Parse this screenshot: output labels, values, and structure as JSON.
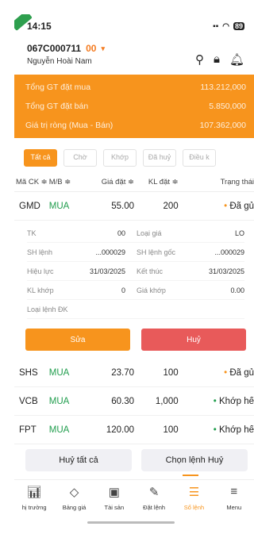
{
  "status": {
    "time": "14:15",
    "battery": "89",
    "signal": "∷",
    "wifi": "☷"
  },
  "account": {
    "id": "067C000711",
    "sub": "00",
    "name": "Nguyễn Hoài Nam"
  },
  "summary": [
    {
      "label": "Tổng GT đặt mua",
      "value": "113.212,000"
    },
    {
      "label": "Tổng GT đặt bán",
      "value": "5.850,000"
    },
    {
      "label": "Giá trị ròng (Mua - Bán)",
      "value": "107.362,000"
    }
  ],
  "tabs": [
    "Tất cả",
    "Chờ",
    "Khớp",
    "Đã huỷ",
    "Điều k"
  ],
  "table": {
    "headers": [
      "Mã CK ≑",
      "M/B ≑",
      "Giá đặt ≑",
      "KL đặt ≑",
      "Trạng thái"
    ],
    "rows": [
      {
        "symbol": "GMD",
        "side": "MUA",
        "price": "55.00",
        "qty": "200",
        "status": "Đã gủ"
      },
      {
        "symbol": "SHS",
        "side": "MUA",
        "price": "23.70",
        "qty": "100",
        "status": "Đã gủ"
      },
      {
        "symbol": "VCB",
        "side": "MUA",
        "price": "60.30",
        "qty": "1,000",
        "status": "Khớp hế"
      },
      {
        "symbol": "FPT",
        "side": "MUA",
        "price": "120.00",
        "qty": "100",
        "status": "Khớp hế"
      }
    ]
  },
  "details": {
    "tk_label": "TK",
    "tk_value": "00",
    "loaigia_label": "Loại giá",
    "loaigia_value": "LO",
    "shlenh_label": "SH lệnh",
    "shlenh_value": "...000029",
    "shlenhgoc_label": "SH lệnh gốc",
    "shlenhgoc_value": "...000029",
    "hieuluc_label": "Hiệu lực",
    "hieuluc_value": "31/03/2025",
    "ketthuc_label": "Kết thúc",
    "ketthuc_value": "31/03/2025",
    "klkhop_label": "KL khớp",
    "klkhop_value": "0",
    "giakhop_label": "Giá khớp",
    "giakhop_value": "0.00",
    "loailenh_label": "Loại lệnh ĐK"
  },
  "actions": {
    "edit": "Sửa",
    "cancel": "Huỷ"
  },
  "bottom": {
    "cancel_all": "Huỷ tất cả",
    "select_cancel": "Chọn lệnh Huỷ"
  },
  "nav": [
    {
      "label": "hị trường",
      "icon": "chart-icon"
    },
    {
      "label": "Bảng giá",
      "icon": "tag-icon"
    },
    {
      "label": "Tài sản",
      "icon": "wallet-icon"
    },
    {
      "label": "Đặt lệnh",
      "icon": "order-icon"
    },
    {
      "label": "Sổ lệnh",
      "icon": "list-icon"
    },
    {
      "label": "Menu",
      "icon": "menu-icon"
    }
  ],
  "colors": {
    "accent": "#f7941d",
    "buy": "#1f9d4c",
    "cancel": "#e85a5a"
  }
}
